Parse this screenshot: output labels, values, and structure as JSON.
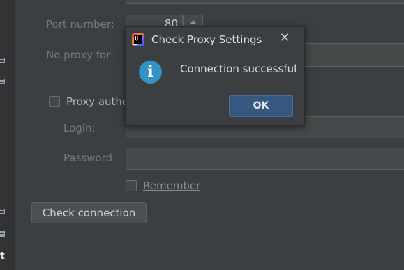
{
  "window": {
    "partial_edge_label": "t"
  },
  "form": {
    "port_label": "Port number:",
    "port_value": "80",
    "no_proxy_label": "No proxy for:",
    "proxy_auth_label_visible": "Proxy authe",
    "login_label": "Login:",
    "password_label": "Password:",
    "remember_label": "Remember",
    "check_connection_label": "Check connection"
  },
  "dialog": {
    "title": "Check Proxy Settings",
    "close_glyph": "✕",
    "message": "Connection successful",
    "ok_label": "OK",
    "info_glyph": "i",
    "app_logo_text": "IJ"
  },
  "colors": {
    "background": "#3c3f41",
    "info_icon": "#3592c4",
    "ok_button": "#365880",
    "label_text": "#787878"
  },
  "icons": [
    "app-logo-icon",
    "info-icon",
    "close-icon",
    "spinner-up-icon",
    "tool-window-icon"
  ]
}
